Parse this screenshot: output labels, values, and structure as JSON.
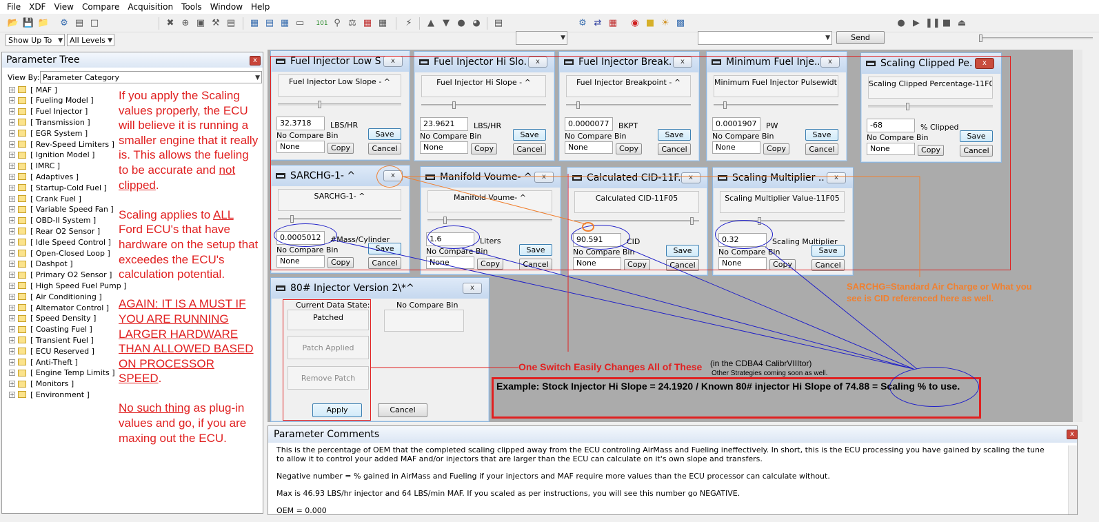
{
  "menubar": [
    "File",
    "XDF",
    "View",
    "Compare",
    "Acquisition",
    "Tools",
    "Window",
    "Help"
  ],
  "toolbar": {
    "show_up_to": "Show Up To",
    "all_levels": "All Levels",
    "send": "Send"
  },
  "tree": {
    "title": "Parameter Tree",
    "view_by_label": "View By:",
    "view_by_value": "Parameter Category",
    "items": [
      "[ MAF ]",
      "[ Fueling Model ]",
      "[ Fuel Injector ]",
      "[ Transmission ]",
      "[ EGR System ]",
      "[ Rev-Speed Limiters ]",
      "[ Ignition Model ]",
      "[ IMRC ]",
      "[ Adaptives ]",
      "[ Startup-Cold Fuel ]",
      "[ Crank Fuel ]",
      "[ Variable Speed Fan ]",
      "[ OBD-II System ]",
      "[ Rear O2 Sensor ]",
      "[ Idle Speed Control ]",
      "[ Open-Closed Loop ]",
      "[ Dashpot ]",
      "[ Primary O2 Sensor ]",
      "[ High Speed Fuel Pump ]",
      "[ Air Conditioning ]",
      "[ Alternator Control ]",
      "[ Speed Density ]",
      "[ Coasting Fuel ]",
      "[ Transient Fuel ]",
      "[ ECU Reserved ]",
      "[ Anti-Theft ]",
      "[ Engine Temp Limits ]",
      "[ Monitors ]",
      "[ Environment ]"
    ]
  },
  "note": {
    "p1a": "If you apply the Scaling values properly, the ECU will believe it is running a smaller engine that it really is. This allows the fueling to be accurate and ",
    "p1u": "not clipped",
    "p1b": ".",
    "p2a": "Scaling applies to ",
    "p2u": "ALL",
    "p2b": " Ford ECU's that have hardware on the setup that exceedes the ECU's calculation potential.",
    "p3u": "AGAIN: IT IS A MUST IF YOU ARE RUNNING LARGER HARDWARE THAN ALLOWED BASED ON PROCESSOR SPEED",
    "p3b": ".",
    "p4u": "No such thing",
    "p4b": " as plug-in values and go, if you are maxing out the ECU."
  },
  "common": {
    "no_compare": "No Compare Bin",
    "none": "None",
    "copy": "Copy",
    "save": "Save",
    "cancel": "Cancel",
    "close": "x"
  },
  "windows": [
    {
      "title": "Fuel Injector Low S...",
      "label": "Fuel Injector Low Slope - ^",
      "value": "32.3718",
      "unit": "LBS/HR"
    },
    {
      "title": "Fuel Injector Hi Slo...",
      "label": "Fuel Injector Hi Slope - ^",
      "value": "23.9621",
      "unit": "LBS/HR"
    },
    {
      "title": "Fuel Injector Break...",
      "label": "Fuel Injector Breakpoint - ^",
      "value": "0.0000077",
      "unit": "BKPT"
    },
    {
      "title": "Minimum Fuel Inje...",
      "label": "Minimum Fuel Injector Pulsewidth",
      "value": "0.0001907",
      "unit": "PW"
    },
    {
      "title": "Scaling Clipped Pe...",
      "label": "Scaling Clipped Percentage-11F05",
      "value": "-68",
      "unit": "% Clipped"
    },
    {
      "title": "SARCHG-1- ^",
      "label": "SARCHG-1- ^",
      "value": "0.0005012",
      "unit": "#Mass/Cylinder"
    },
    {
      "title": "Manifold Voume- ^",
      "label": "Manifold Voume- ^",
      "value": "1.6",
      "unit": "Liters"
    },
    {
      "title": "Calculated CID-11F...",
      "label": "Calculated CID-11F05",
      "value": "90.591",
      "unit": "CID"
    },
    {
      "title": "Scaling Multiplier ...",
      "label": "Scaling Multiplier Value-11F05",
      "value": "0.32",
      "unit": "Scaling Multiplier"
    }
  ],
  "patch": {
    "title": "80# Injector Version 2\\*^",
    "current_state": "Current Data State:",
    "state_value": "Patched",
    "no_compare": "No Compare Bin",
    "patch_applied": "Patch Applied",
    "remove_patch": "Remove Patch",
    "apply": "Apply",
    "cancel": "Cancel"
  },
  "annotations": {
    "sarchg": "SARCHG=Standard Air Charge or What you see is CID referenced here as well.",
    "switch": "One Switch Easily Changes All of These",
    "cdba4": "(in the CDBA4 CalibrVIIItor)",
    "other": "Other Strategies coming soon as well.",
    "example": "Example: Stock Injector Hi Slope = 24.1920 / Known 80# injector Hi Slope of 74.88 = Scaling % to use."
  },
  "comments": {
    "title": "Parameter Comments",
    "lines": [
      "This is the percentage of OEM that the completed scaling clipped away from the ECU controling AirMass and Fueling ineffectively. In short, this is the ECU processing you have gained by scaling the tune to allow it to control your added MAF and/or injectors that are larger than the ECU can calculate on it's own slope and transfers.",
      "Negative number = % gained in AirMass and Fueling if your injectors and MAF require more values than the ECU processor can calculate without.",
      "Max is 46.93 LBS/hr injector and 64 LBS/min MAF. If you scaled as per instructions, you will see this number go NEGATIVE.",
      "OEM = 0.000"
    ]
  },
  "colors": {
    "annotation_red": "#e02020",
    "annotation_orange": "#f08030",
    "annotation_blue": "#2020c8"
  }
}
